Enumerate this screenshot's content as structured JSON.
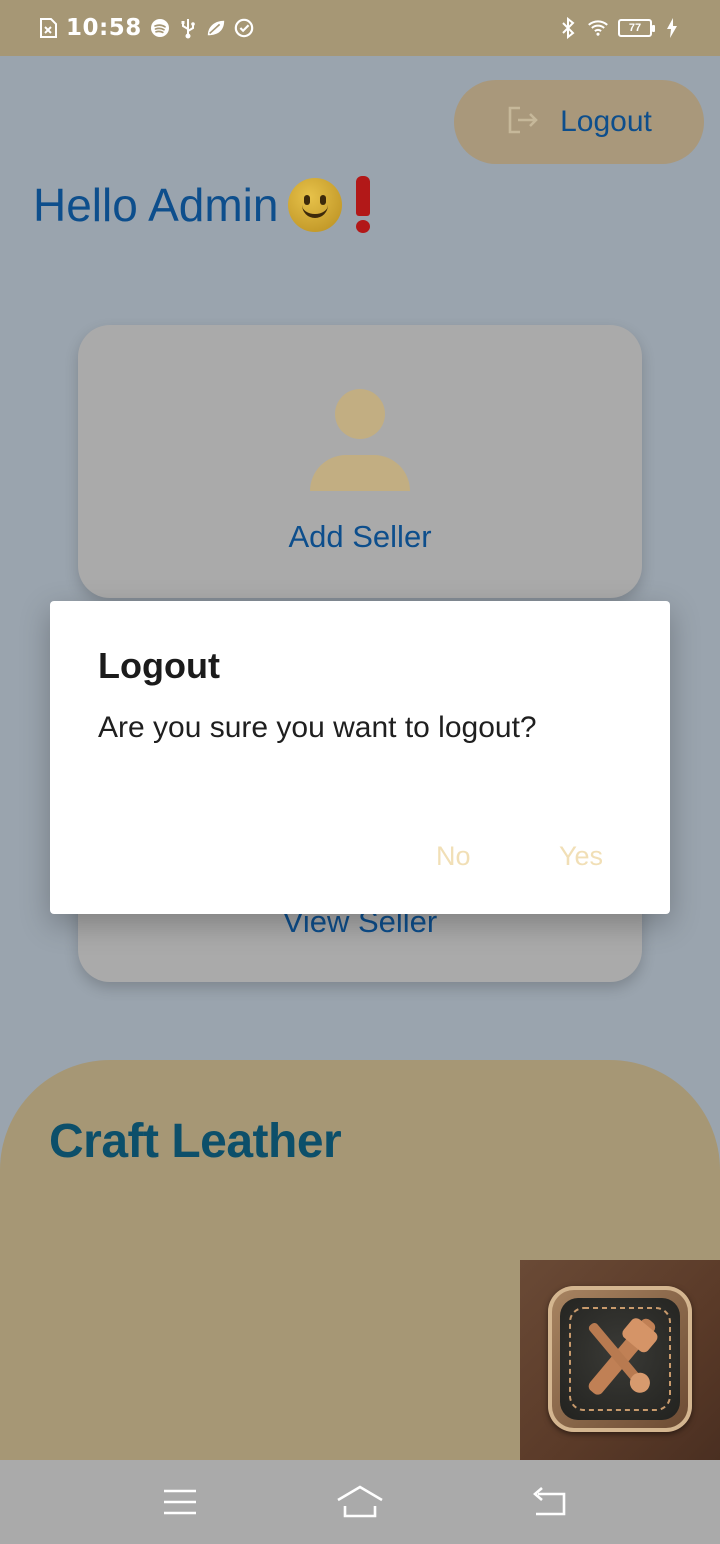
{
  "status_bar": {
    "time": "10:58",
    "battery_level": "77",
    "left_icons": [
      "sim-error-icon",
      "spotify-icon",
      "usb-icon",
      "leaf-app-icon",
      "sync-app-icon"
    ],
    "right_icons": [
      "bluetooth-icon",
      "wifi-icon",
      "battery-icon",
      "charging-bolt-icon"
    ]
  },
  "header": {
    "logout_label": "Logout",
    "greeting": "Hello Admin"
  },
  "cards": [
    {
      "label": "Add Seller",
      "icon": "person-icon"
    },
    {
      "label": "View Seller"
    }
  ],
  "brand": {
    "name": "Craft Leather",
    "logo_icon": "leather-tools-app-logo"
  },
  "dialog": {
    "title": "Logout",
    "message": "Are you sure you want to logout?",
    "no_label": "No",
    "yes_label": "Yes"
  },
  "nav_bar": {
    "icons": [
      "menu-icon",
      "home-icon",
      "back-icon"
    ]
  },
  "colors": {
    "status_bar": "#a69775",
    "background": "#9aa4ae",
    "accent_text": "#0d4e8c",
    "brand_text": "#0c4f6a",
    "card": "#aaaaaa",
    "dialog_buttons": "#f1dfb6"
  }
}
